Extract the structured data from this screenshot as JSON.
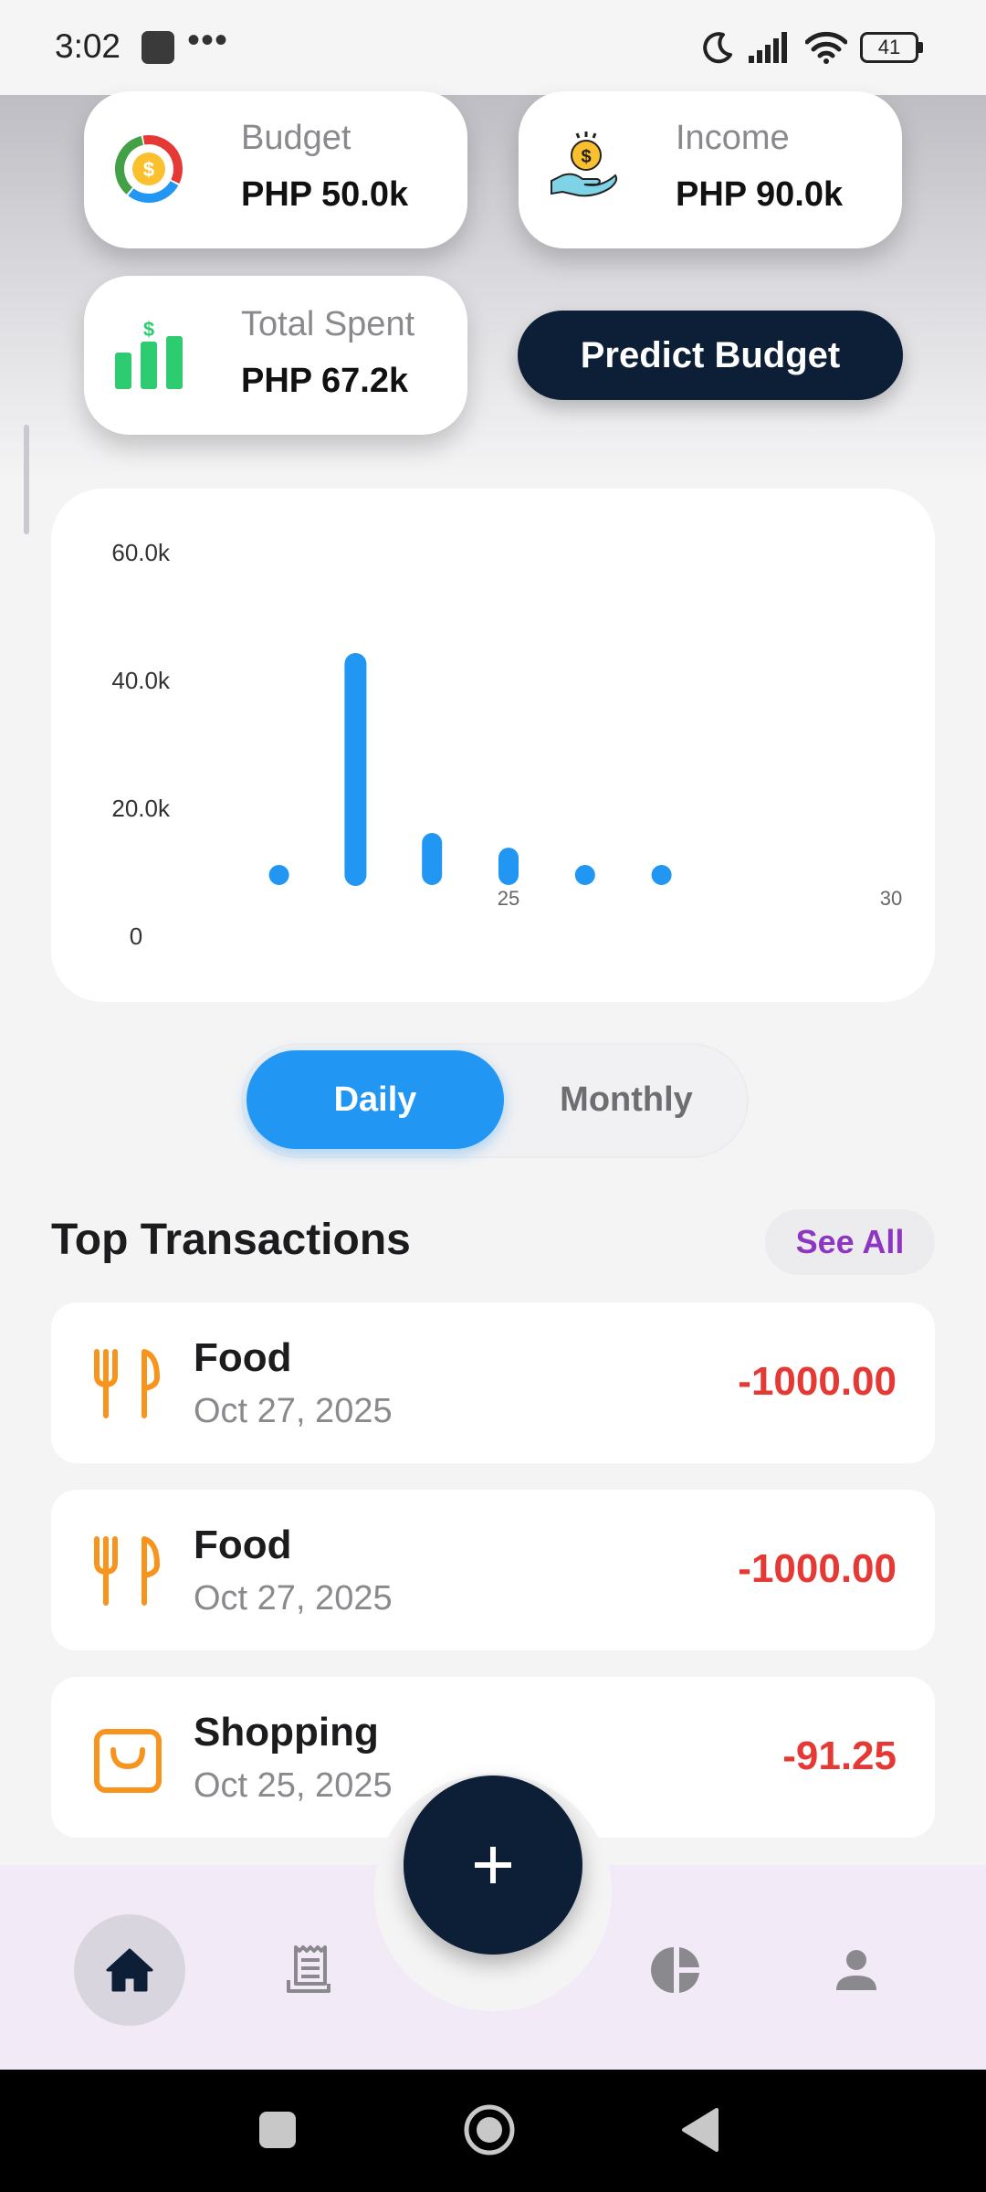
{
  "status_bar": {
    "time": "3:02",
    "dots": "•••",
    "battery": "41"
  },
  "summary": {
    "budget": {
      "label": "Budget",
      "value": "PHP 50.0k",
      "icon": "donut-dollar-icon"
    },
    "income": {
      "label": "Income",
      "value": "PHP 90.0k",
      "icon": "hand-coin-icon"
    },
    "total_spent": {
      "label": "Total Spent",
      "value": "PHP 67.2k",
      "icon": "bar-chart-dollar-icon"
    }
  },
  "predict_button": "Predict Budget",
  "chart_data": {
    "type": "bar",
    "y_ticks": [
      "0",
      "20.0k",
      "40.0k",
      "60.0k"
    ],
    "ylim": [
      0,
      60000
    ],
    "x_tick_labels": [
      {
        "x": 25,
        "label": "25"
      },
      {
        "x": 30,
        "label": "30"
      }
    ],
    "xlim": [
      20,
      30
    ],
    "x": [
      22,
      23,
      24,
      25,
      26,
      27
    ],
    "values": [
      0,
      33000,
      5000,
      2700,
      0,
      0
    ],
    "color": "#2196f3",
    "grid": false
  },
  "toggle": {
    "active": "Daily",
    "inactive": "Monthly"
  },
  "section": {
    "title": "Top Transactions",
    "see_all": "See All"
  },
  "transactions": [
    {
      "title": "Food",
      "date": "Oct 27, 2025",
      "amount": "-1000.00",
      "icon": "fork-knife-icon"
    },
    {
      "title": "Food",
      "date": "Oct 27, 2025",
      "amount": "-1000.00",
      "icon": "fork-knife-icon"
    },
    {
      "title": "Shopping",
      "date": "Oct 25, 2025",
      "amount": "-91.25",
      "icon": "shopping-bag-icon"
    }
  ],
  "colors": {
    "accent": "#2196f3",
    "dark": "#0c1f36",
    "negative": "#e53935",
    "see_all": "#8e35c2",
    "food": "#f7941d"
  },
  "nav": {
    "items": [
      "home-icon",
      "receipt-icon",
      "pie-chart-icon",
      "person-icon"
    ],
    "active": "home-icon"
  }
}
